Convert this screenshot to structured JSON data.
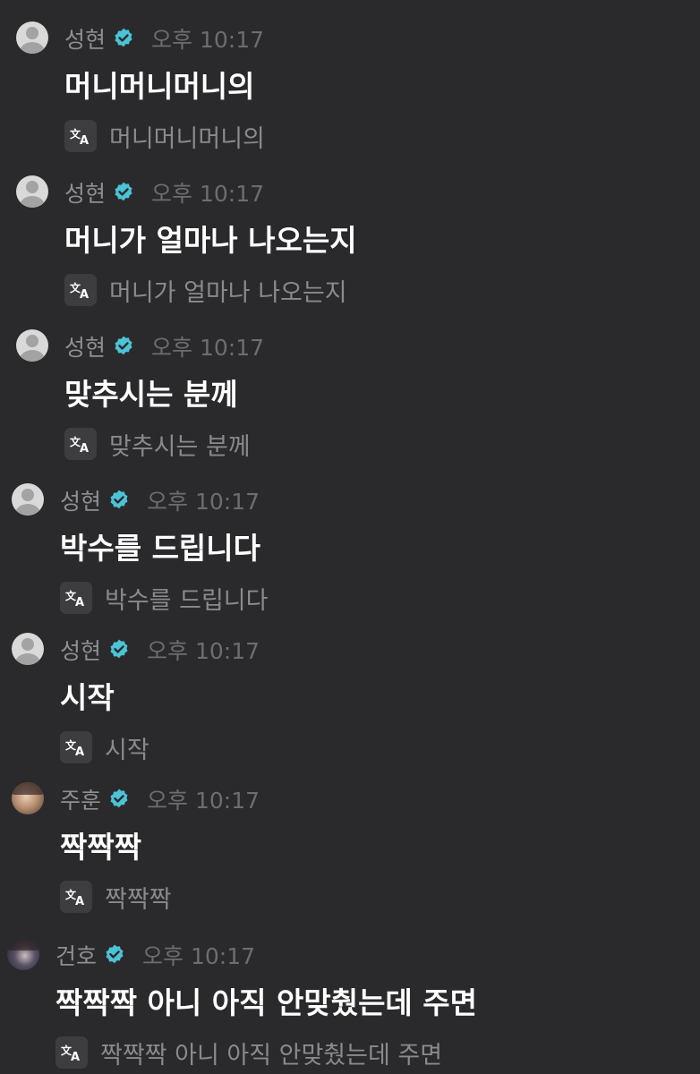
{
  "messages": [
    {
      "name": "성현",
      "time": "오후 10:17",
      "text": "머니머니머니의",
      "translation": "머니머니머니의",
      "avatar": "default-avatar"
    },
    {
      "name": "성현",
      "time": "오후 10:17",
      "text": "머니가 얼마나 나오는지",
      "translation": "머니가 얼마나 나오는지",
      "avatar": "default-avatar"
    },
    {
      "name": "성현",
      "time": "오후 10:17",
      "text": "맞추시는 분께",
      "translation": "맞추시는 분께",
      "avatar": "default-avatar"
    },
    {
      "name": "성현",
      "time": "오후 10:17",
      "text": "박수를 드립니다",
      "translation": "박수를 드립니다",
      "avatar": "default-avatar"
    },
    {
      "name": "성현",
      "time": "오후 10:17",
      "text": "시작",
      "translation": "시작",
      "avatar": "default-avatar"
    },
    {
      "name": "주훈",
      "time": "오후 10:17",
      "text": "짝짝짝",
      "translation": "짝짝짝",
      "avatar": "profile-photo"
    },
    {
      "name": "건호",
      "time": "오후 10:17",
      "text": "짝짝짝 아니 아직 안맞췄는데 주면",
      "translation": "짝짝짝 아니 아직 안맞췄는데 주면",
      "avatar": "profile-photo"
    }
  ],
  "colors": {
    "background": "#2a2a2c",
    "verified_badge": "#4cc3d6",
    "name": "#8f8f93",
    "timestamp": "#6d6d71",
    "translation": "#8a8a8e"
  },
  "icons": {
    "verified": "verified-badge-icon",
    "translate": "translate-icon"
  }
}
